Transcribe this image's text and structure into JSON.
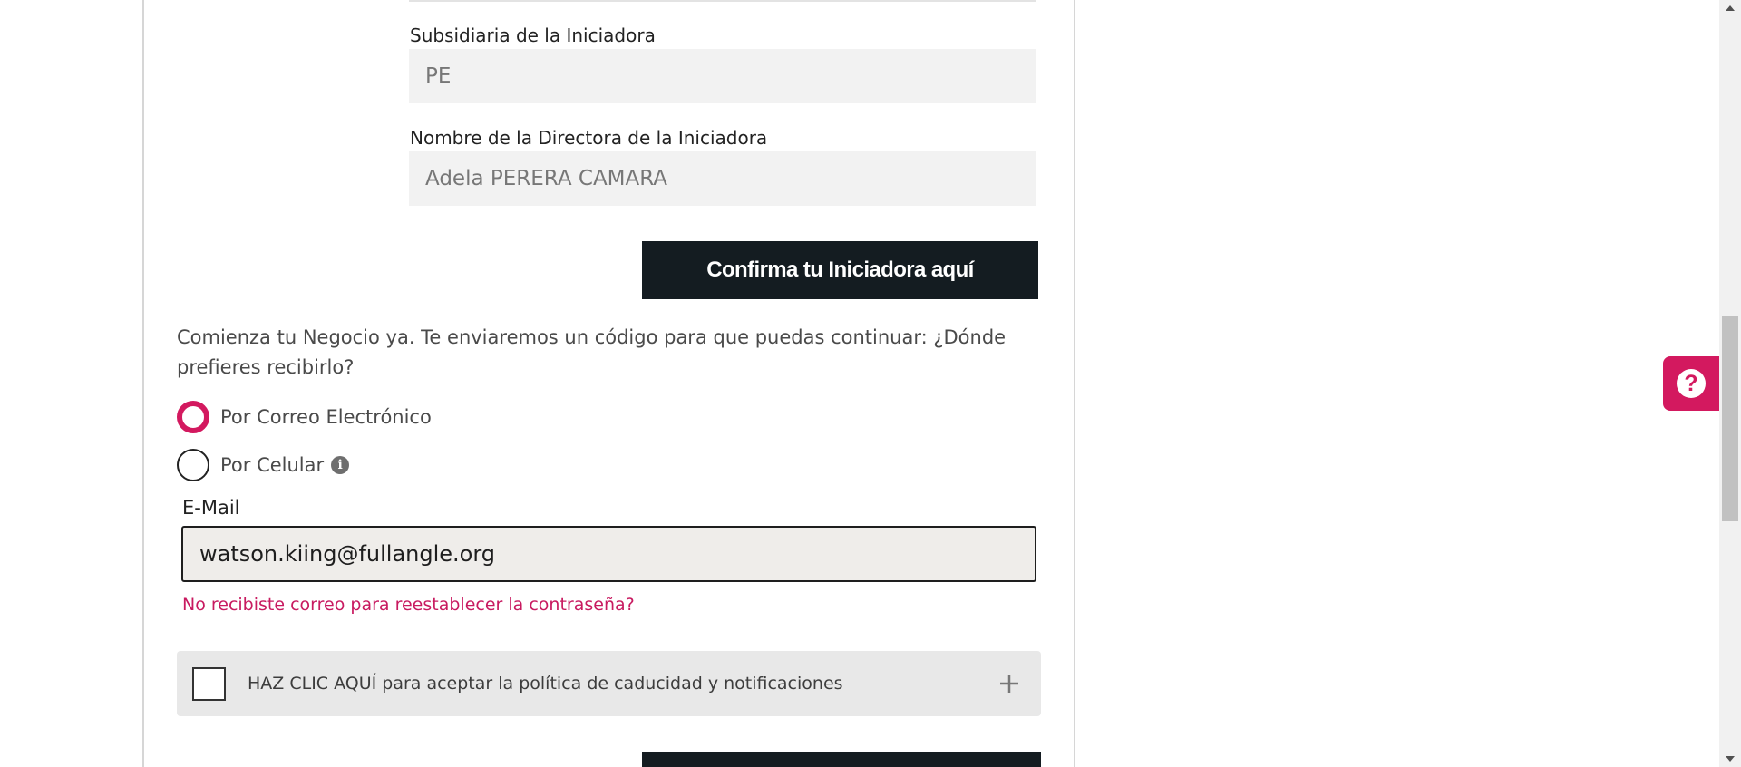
{
  "form": {
    "subsidiary": {
      "label": "Subsidiaria de la Iniciadora",
      "value": "PE"
    },
    "director": {
      "label": "Nombre de la Directora de la Iniciadora",
      "value": "Adela PERERA CAMARA"
    },
    "confirm_button": "Confirma tu Iniciadora aquí",
    "prompt": "Comienza tu Negocio ya. Te enviaremos un código para que puedas continuar: ¿Dónde prefieres recibirlo?",
    "options": {
      "email": {
        "label": "Por Correo Electrónico",
        "selected": true
      },
      "phone": {
        "label": "Por Celular",
        "selected": false,
        "info_icon": "info-icon"
      }
    },
    "email": {
      "label": "E-Mail",
      "value": "watson.kiing@fullangle.org"
    },
    "forgot_link": "No recibiste correo para reestablecer la contraseña?",
    "policy": {
      "label": "HAZ CLIC AQUÍ para aceptar la política de caducidad y notificaciones",
      "checked": false,
      "expand_icon": "plus-icon"
    }
  },
  "help": {
    "icon": "question-icon"
  },
  "colors": {
    "brand": "#d3195f",
    "button": "#141c21",
    "field_bg": "#f2f2f2"
  }
}
